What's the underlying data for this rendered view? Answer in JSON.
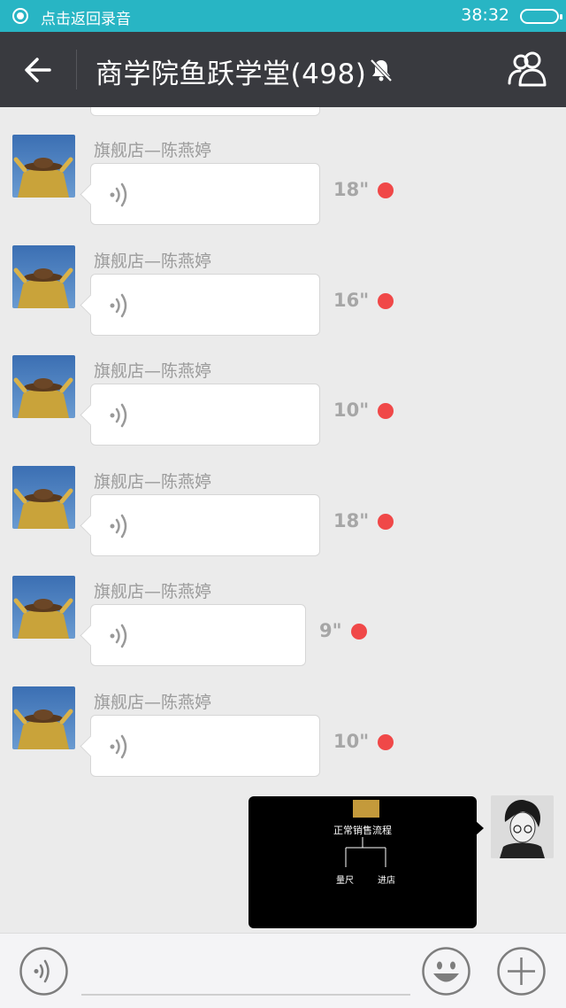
{
  "status_bar": {
    "recording_text": "点击返回录音",
    "time": "38:32"
  },
  "header": {
    "title": "商学院鱼跃学堂(498)"
  },
  "messages": [
    {
      "sender": "旗舰店—陈燕婷",
      "duration": "18\""
    },
    {
      "sender": "旗舰店—陈燕婷",
      "duration": "16\""
    },
    {
      "sender": "旗舰店—陈燕婷",
      "duration": "10\""
    },
    {
      "sender": "旗舰店—陈燕婷",
      "duration": "18\""
    },
    {
      "sender": "旗舰店—陈燕婷",
      "duration": "9\""
    },
    {
      "sender": "旗舰店—陈燕婷",
      "duration": "10\""
    }
  ],
  "image_message": {
    "title": "正常销售流程",
    "branch_left": "量尺",
    "branch_right": "进店"
  },
  "input_bar": {
    "placeholder": ""
  },
  "colors": {
    "status_bar": "#28b5c4",
    "nav_bar": "#393a3f",
    "chat_bg": "#ebebeb",
    "unread_dot": "#f04848"
  }
}
